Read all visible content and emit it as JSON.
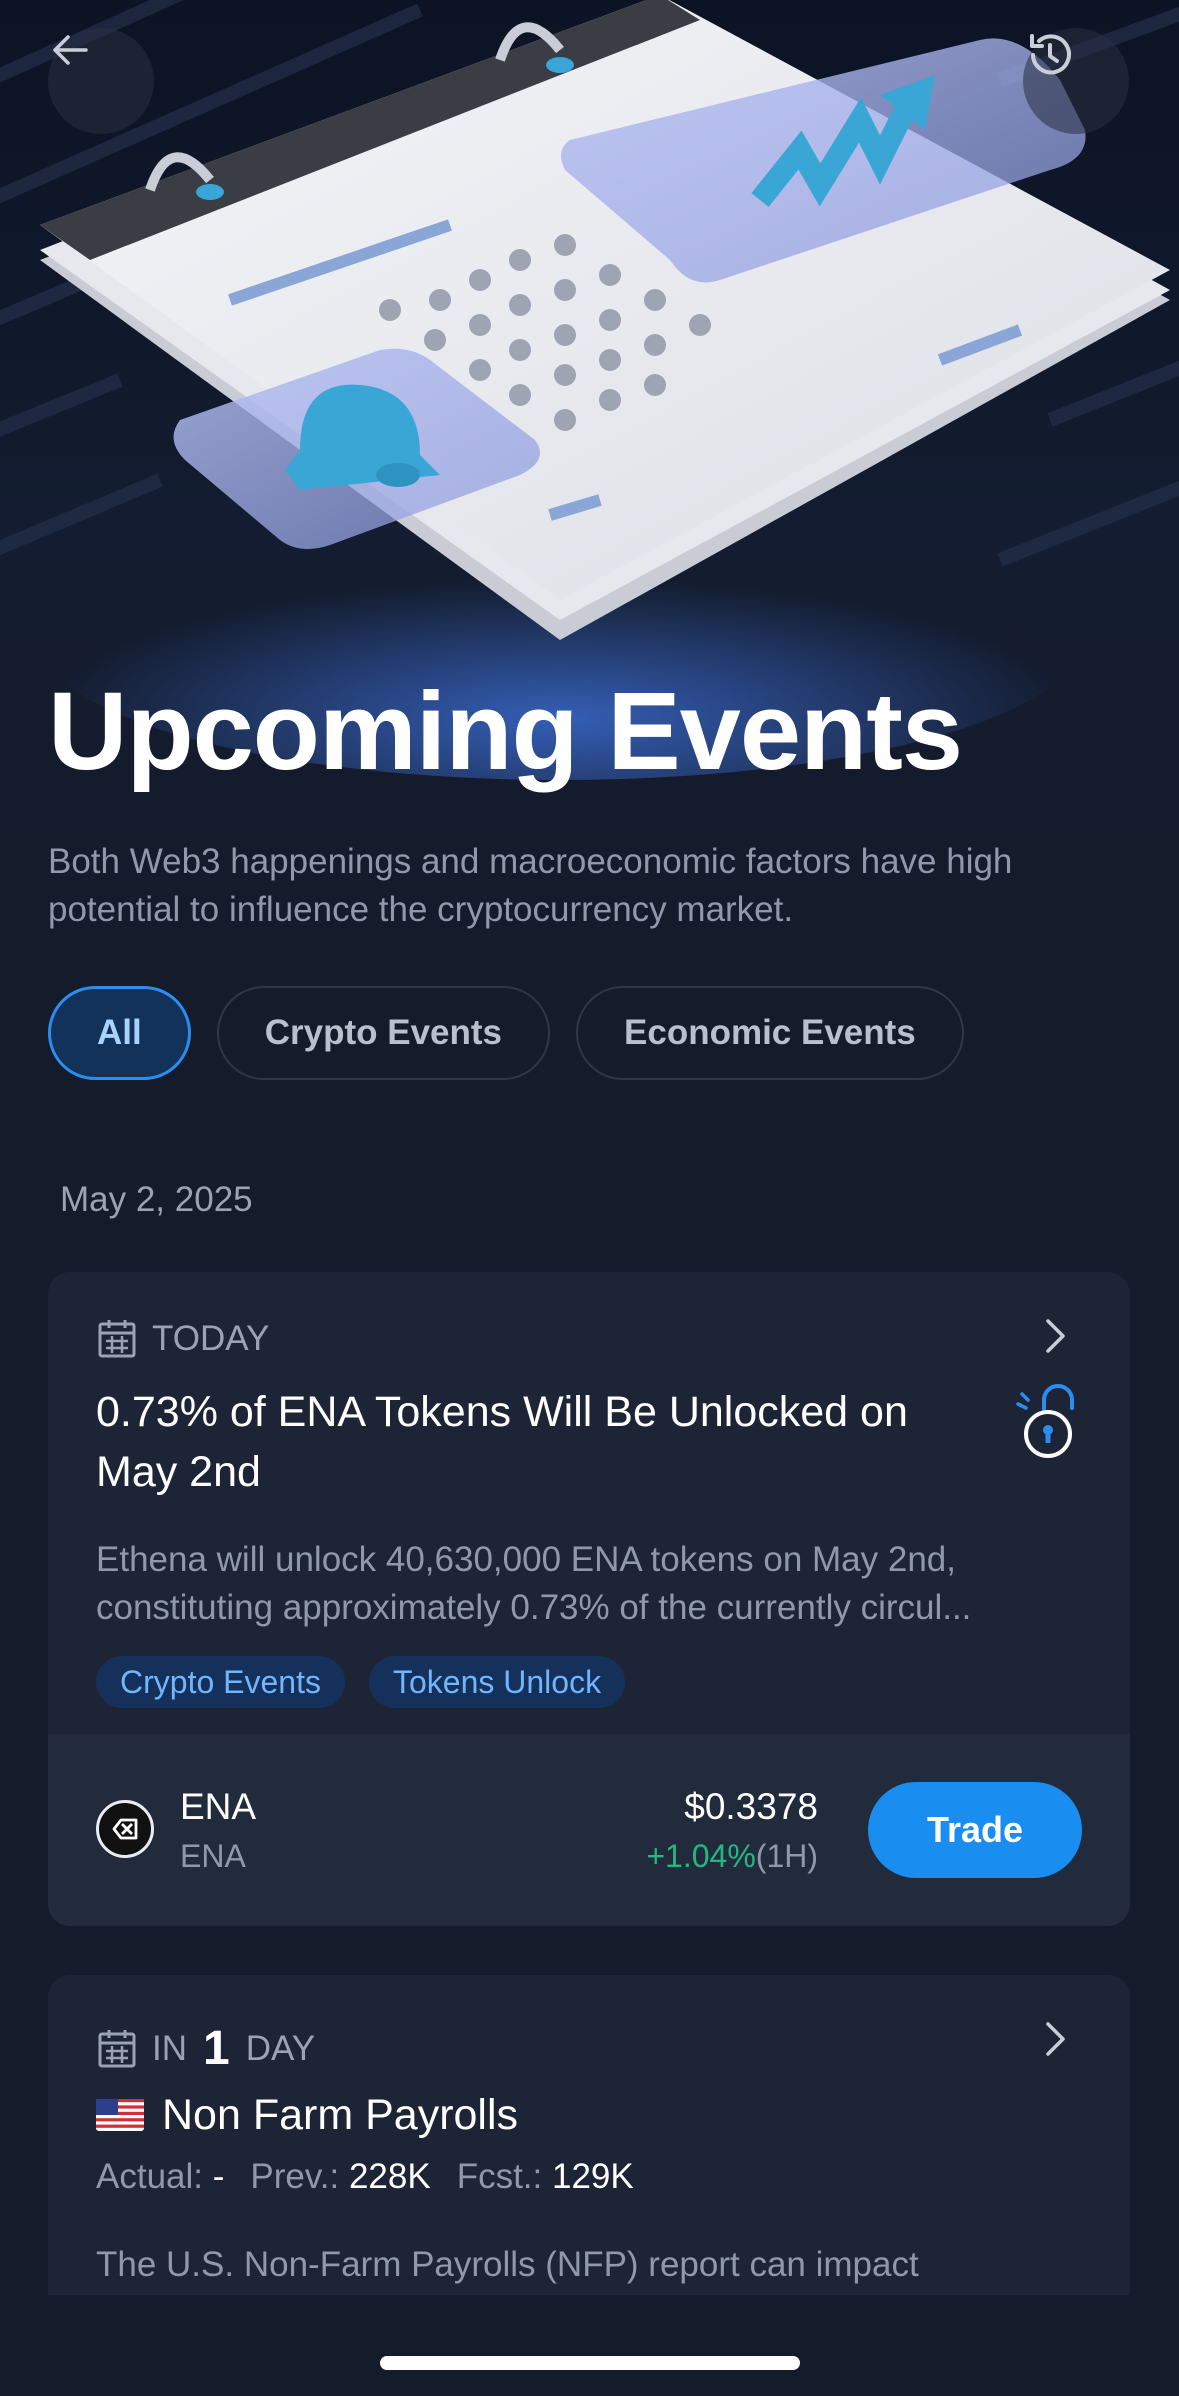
{
  "header": {
    "back_icon": "arrow-left-icon",
    "history_icon": "history-clock-icon",
    "title": "Upcoming Events",
    "subtitle": "Both Web3 happenings and macroeconomic factors have high potential to influence the cryptocurrency market."
  },
  "tabs": [
    {
      "label": "All",
      "active": true
    },
    {
      "label": "Crypto Events",
      "active": false
    },
    {
      "label": "Economic Events",
      "active": false
    }
  ],
  "date_header": "May 2, 2025",
  "events": [
    {
      "when": "TODAY",
      "title": "0.73% of ENA Tokens Will Be Unlocked on May 2nd",
      "description": "Ethena will unlock 40,630,000 ENA tokens on May 2nd, constituting approximately 0.73% of the currently circul...",
      "chips": [
        "Crypto Events",
        "Tokens Unlock"
      ],
      "asset": {
        "name": "ENA",
        "sub": "ENA",
        "price": "$0.3378",
        "change": "+1.04%",
        "period": "(1H)",
        "trade_label": "Trade"
      }
    },
    {
      "when_prefix": "IN",
      "when_number": "1",
      "when_suffix": "DAY",
      "flag": "🇺🇸",
      "title": "Non Farm Payrolls",
      "actual_label": "Actual:",
      "actual_value": "-",
      "prev_label": "Prev.:",
      "prev_value": "228K",
      "fcst_label": "Fcst.:",
      "fcst_value": "129K",
      "description": "The U.S. Non-Farm Payrolls (NFP) report can impact"
    }
  ],
  "colors": {
    "background": "#141b2b",
    "card": "#1c2435",
    "accent": "#1a8df0",
    "positive": "#22b883"
  }
}
